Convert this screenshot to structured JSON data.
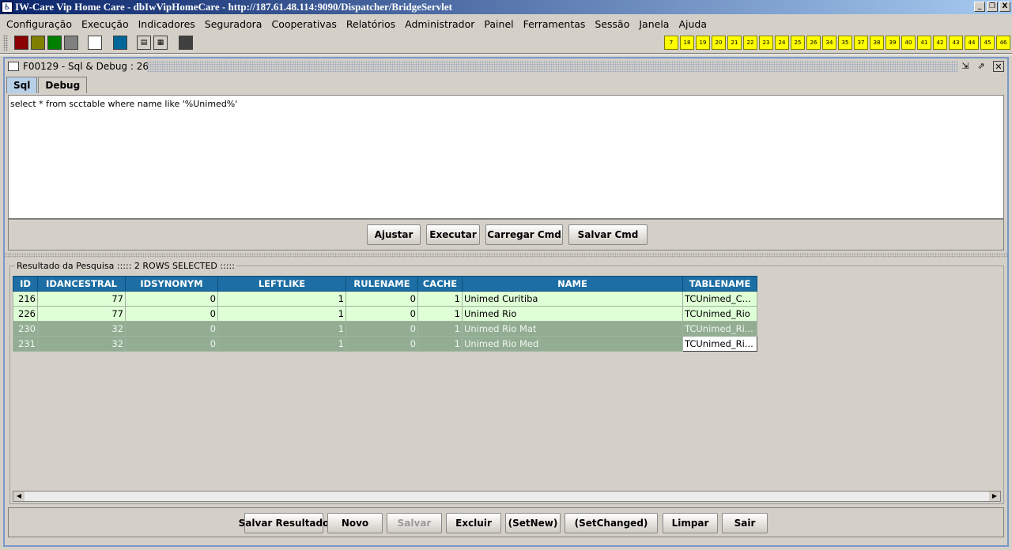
{
  "window": {
    "title": "IW-Care Vip Home Care - dbIwVipHomeCare - http://187.61.48.114:9090/Dispatcher/BridgeServlet",
    "controls": [
      "_",
      "❐",
      "X"
    ]
  },
  "menu": [
    "Configuração",
    "Execução",
    "Indicadores",
    "Seguradora",
    "Cooperativas",
    "Relatórios",
    "Administrador",
    "Painel",
    "Ferramentas",
    "Sessão",
    "Janela",
    "Ajuda"
  ],
  "toolbar": {
    "swatches": [
      "#8b0000",
      "#808000",
      "#008000",
      "#808080",
      "#ffffff",
      "#006699"
    ],
    "shortcut_numbers": [
      "7",
      "18",
      "19",
      "20",
      "21",
      "22",
      "23",
      "24",
      "25",
      "26",
      "34",
      "35",
      "37",
      "38",
      "39",
      "40",
      "41",
      "42",
      "43",
      "44",
      "45",
      "46"
    ]
  },
  "frame": {
    "title": "F00129 - Sql & Debug : 26",
    "tabs": [
      "Sql",
      "Debug"
    ],
    "active_tab": "Sql"
  },
  "sql": {
    "query": "select * from scctable where name like '%Unimed%'"
  },
  "sql_buttons": [
    "Ajustar",
    "Executar",
    "Carregar Cmd",
    "Salvar Cmd"
  ],
  "result": {
    "legend": "Resultado da Pesquisa ::::: 2 ROWS SELECTED :::::",
    "columns": [
      "ID",
      "IDANCESTRAL",
      "IDSYNONYM",
      "LEFTLIKE",
      "RULENAME",
      "CACHE",
      "NAME",
      "TABLENAME"
    ],
    "rows": [
      [
        "216",
        "77",
        "0",
        "1",
        "0",
        "1",
        "Unimed Curitiba",
        "TCUnimed_C..."
      ],
      [
        "226",
        "77",
        "0",
        "1",
        "0",
        "1",
        "Unimed Rio",
        "TCUnimed_Rio"
      ],
      [
        "230",
        "32",
        "0",
        "1",
        "0",
        "1",
        "Unimed Rio Mat",
        "TCUnimed_Ri..."
      ],
      [
        "231",
        "32",
        "0",
        "1",
        "0",
        "1",
        "Unimed Rio Med",
        "TCUnimed_Ri..."
      ]
    ]
  },
  "bottom_buttons": {
    "salvar_resultado": "Salvar Resultado",
    "novo": "Novo",
    "salvar": "Salvar",
    "excluir": "Excluir",
    "setnew": "(SetNew)",
    "setchanged": "(SetChanged)",
    "limpar": "Limpar",
    "sair": "Sair"
  }
}
